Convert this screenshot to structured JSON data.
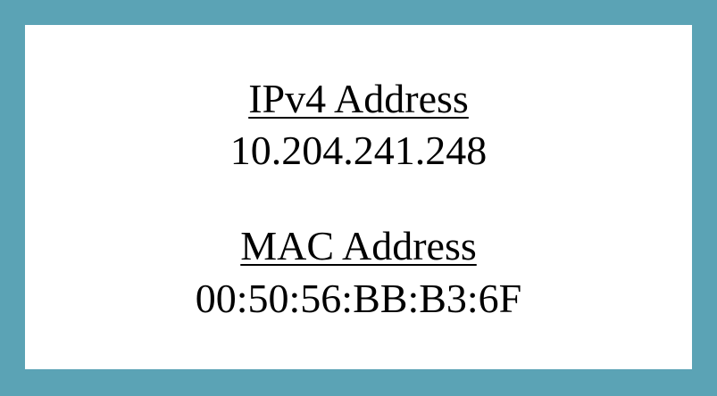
{
  "ipv4": {
    "label": "IPv4 Address",
    "value": "10.204.241.248"
  },
  "mac": {
    "label": "MAC Address",
    "value": "00:50:56:BB:B3:6F"
  },
  "colors": {
    "frame_border": "#5ba3b5",
    "background": "#ffffff",
    "text": "#000000"
  }
}
